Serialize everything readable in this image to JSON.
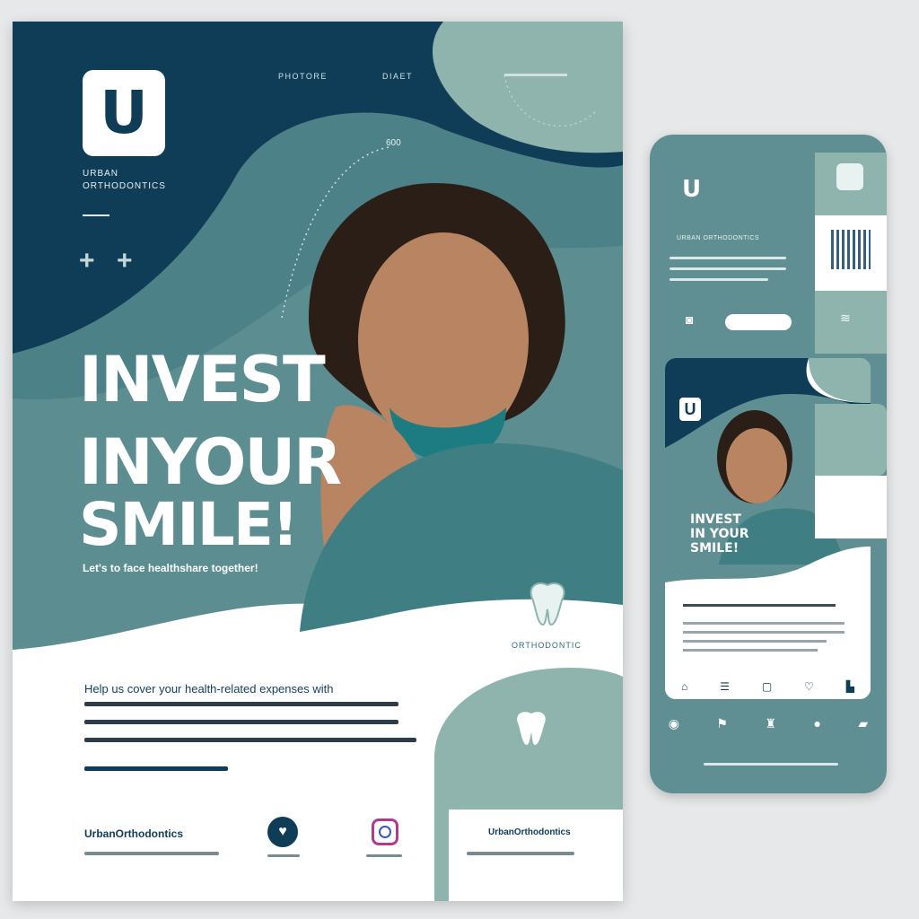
{
  "poster": {
    "logo_letter": "U",
    "brand_line1": "URBAN",
    "brand_line2": "ORTHODONTICS",
    "nav": [
      "PHOTORE",
      "DIAET"
    ],
    "top_right_note": "",
    "callout": "600",
    "headline": [
      "INVEST",
      "INYOUR",
      "SMILE!"
    ],
    "subline": "Let's to face healthshare together!",
    "body_heading": "Help us cover your health-related expenses with",
    "brand_badge": "ORTHODONTIC",
    "footer_brand": "UrbanOrthodontics",
    "footer_social_label": "UrbanOrthodontics",
    "colors": {
      "navy": "#0f3c57",
      "teal": "#5f8f93",
      "mint": "#8fb3ad",
      "white": "#ffffff"
    }
  },
  "phone": {
    "logo_letter": "U",
    "brand_line": "URBAN ORTHODONTICS",
    "card_logo_letter": "U",
    "card_headline": [
      "INVEST",
      "IN YOUR",
      "SMILE!"
    ],
    "button_label": "",
    "icons": [
      "home-icon",
      "bookmark-icon",
      "tooth-icon",
      "record-icon",
      "flag-icon"
    ]
  }
}
